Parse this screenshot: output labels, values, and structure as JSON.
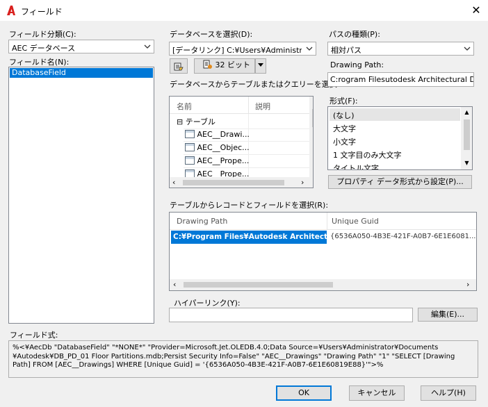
{
  "window": {
    "title": "フィールド",
    "close_icon": "close-icon",
    "app_icon": "autocad-a-icon"
  },
  "left": {
    "category_label": "フィールド分類(C):",
    "category_value": "AEC データベース",
    "field_name_label": "フィールド名(N):",
    "field_names": [
      "DatabaseField"
    ]
  },
  "middle": {
    "db_label": "データベースを選択(D):",
    "db_value": "[データリンク] C:¥Users¥Administrator",
    "bit_button": "32 ビット",
    "table_label": "データベースからテーブルまたはクエリーを選択",
    "columns": [
      "名前",
      "説明"
    ],
    "tree_root": "テーブル",
    "tables": [
      "AEC__Drawi...",
      "AEC__Objec...",
      "AEC__Prope...",
      "AEC__Prope..."
    ]
  },
  "right": {
    "path_type_label": "パスの種類(P):",
    "path_type_value": "相対パス",
    "drawing_path_label": "Drawing Path:",
    "drawing_path_value": "C:rogram Filesutodesk Architectural Des",
    "format_label": "形式(F):",
    "formats": [
      "(なし)",
      "大文字",
      "小文字",
      "1 文字目のみ大文字",
      "タイトル文字"
    ],
    "property_button": "プロパティ データ形式から設定(P)..."
  },
  "records": {
    "label": "テーブルからレコードとフィールドを選択(R):",
    "columns": [
      "Drawing Path",
      "Unique Guid"
    ],
    "row": [
      "C:¥Program Files¥Autodesk Architectur...",
      "{6536A050-4B3E-421F-A0B7-6E1E6081..."
    ]
  },
  "hyperlink": {
    "label": "ハイパーリンク(Y):",
    "edit_button": "編集(E)..."
  },
  "formula": {
    "label": "フィールド式:",
    "lines": [
      "%<¥AecDb \"DatabaseField\" \"*NONE*\" \"Provider=Microsoft.Jet.OLEDB.4.0;Data Source=¥Users¥Administrator¥Documents",
      "¥Autodesk¥DB_PD_01 Floor Partitions.mdb;Persist Security Info=False\" \"AEC__Drawings\" \"Drawing Path\" \"1\" \"SELECT [Drawing",
      "Path] FROM [AEC__Drawings] WHERE [Unique Guid] = '{6536A050-4B3E-421F-A0B7-6E1E60819E88}'\">%"
    ]
  },
  "footer": {
    "ok": "OK",
    "cancel": "キャンセル",
    "help": "ヘルプ(H)"
  }
}
